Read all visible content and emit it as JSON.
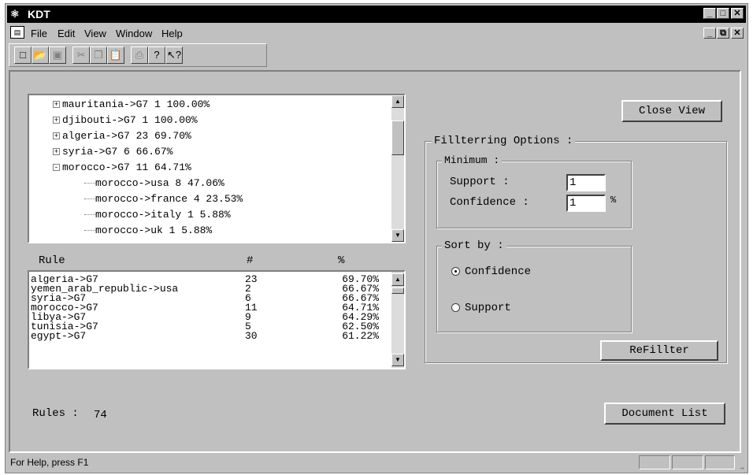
{
  "window": {
    "title": "KDT",
    "app_icon": "kdt-app-icon"
  },
  "menubar": {
    "items": [
      "File",
      "Edit",
      "View",
      "Window",
      "Help"
    ]
  },
  "toolbar": {
    "buttons": [
      "new",
      "open",
      "save",
      "cut",
      "copy",
      "paste",
      "print",
      "help",
      "context-help"
    ]
  },
  "tree": {
    "items": [
      {
        "text": "mauritania->G7 1 100.00%",
        "expander": "+",
        "level": 0
      },
      {
        "text": "djibouti->G7 1 100.00%",
        "expander": "+",
        "level": 0
      },
      {
        "text": "algeria->G7 23 69.70%",
        "expander": "+",
        "level": 0
      },
      {
        "text": "syria->G7 6 66.67%",
        "expander": "+",
        "level": 0
      },
      {
        "text": "morocco->G7 11 64.71%",
        "expander": "-",
        "level": 0
      },
      {
        "text": "morocco->usa 8 47.06%",
        "expander": "",
        "level": 1
      },
      {
        "text": "morocco->france 4 23.53%",
        "expander": "",
        "level": 1
      },
      {
        "text": "morocco->italy 1 5.88%",
        "expander": "",
        "level": 1
      },
      {
        "text": "morocco->uk 1 5.88%",
        "expander": "",
        "level": 1
      }
    ]
  },
  "rules_table": {
    "headers": [
      "Rule",
      "#",
      "%"
    ],
    "rows": [
      [
        "algeria->G7",
        "23",
        "69.70%"
      ],
      [
        "yemen_arab_republic->usa",
        "2",
        "66.67%"
      ],
      [
        "syria->G7",
        "6",
        "66.67%"
      ],
      [
        "morocco->G7",
        "11",
        "64.71%"
      ],
      [
        "libya->G7",
        "9",
        "64.29%"
      ],
      [
        "tunisia->G7",
        "5",
        "62.50%"
      ],
      [
        "egypt->G7",
        "30",
        "61.22%"
      ]
    ]
  },
  "rules_count": {
    "label": "Rules :",
    "value": "74"
  },
  "buttons": {
    "close_view": "Close View",
    "refilter": "ReFillter",
    "document_list": "Document List"
  },
  "filter": {
    "title": "Fillterring Options :",
    "minimum": {
      "title": "Minimum :",
      "support_label": "Support :",
      "support_value": "1",
      "confidence_label": "Confidence :",
      "confidence_value": "1",
      "unit": "%"
    },
    "sort": {
      "title": "Sort by :",
      "options": [
        "Confidence",
        "Support"
      ],
      "selected": "Confidence"
    }
  },
  "status": {
    "text": "For Help, press F1"
  }
}
